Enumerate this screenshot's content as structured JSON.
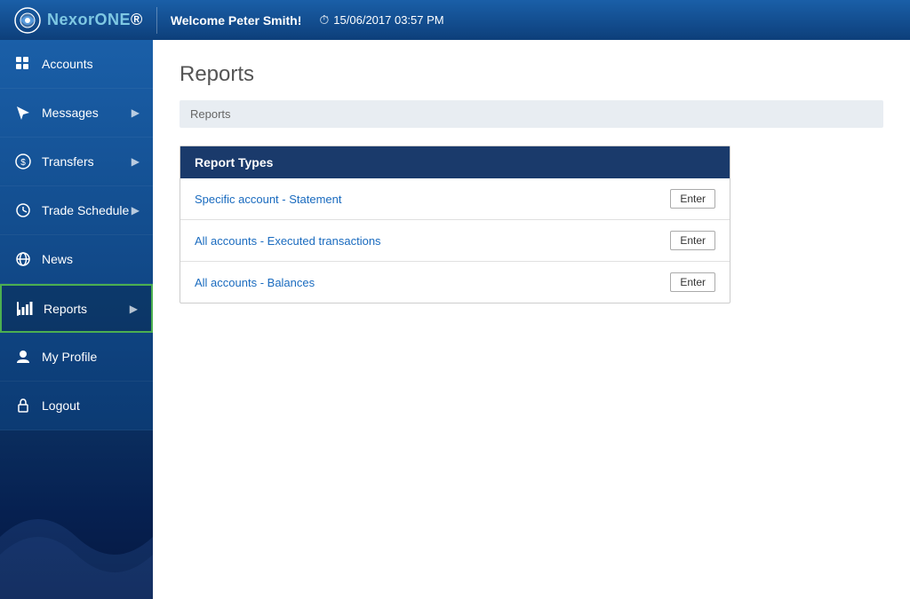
{
  "header": {
    "welcome": "Welcome Peter Smith!",
    "datetime": "15/06/2017 03:57 PM",
    "logo_main": "Nexor",
    "logo_accent": "ONE"
  },
  "sidebar": {
    "items": [
      {
        "id": "accounts",
        "label": "Accounts",
        "icon": "grid",
        "hasArrow": false
      },
      {
        "id": "messages",
        "label": "Messages",
        "icon": "cursor",
        "hasArrow": true
      },
      {
        "id": "transfers",
        "label": "Transfers",
        "icon": "dollar",
        "hasArrow": true
      },
      {
        "id": "trade-schedule",
        "label": "Trade Schedule",
        "icon": "clock",
        "hasArrow": true
      },
      {
        "id": "news",
        "label": "News",
        "icon": "globe",
        "hasArrow": false
      },
      {
        "id": "reports",
        "label": "Reports",
        "icon": "chart",
        "hasArrow": true,
        "active": true
      },
      {
        "id": "my-profile",
        "label": "My Profile",
        "icon": "user",
        "hasArrow": false
      },
      {
        "id": "logout",
        "label": "Logout",
        "icon": "lock",
        "hasArrow": false
      }
    ]
  },
  "page": {
    "title": "Reports",
    "breadcrumb": "Reports",
    "report_types_header": "Report Types",
    "reports": [
      {
        "label": "Specific account - Statement",
        "button": "Enter"
      },
      {
        "label": "All accounts - Executed transactions",
        "button": "Enter"
      },
      {
        "label": "All accounts - Balances",
        "button": "Enter"
      }
    ]
  }
}
